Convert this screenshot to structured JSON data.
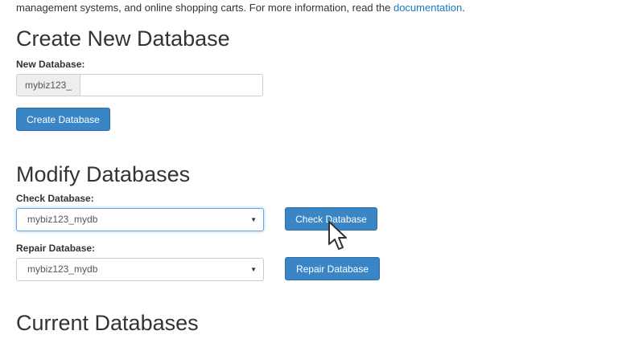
{
  "intro": {
    "text": "management systems, and online shopping carts. For more information, read the ",
    "link": "documentation",
    "end": "."
  },
  "create": {
    "heading": "Create New Database",
    "label": "New Database:",
    "prefix": "mybiz123_",
    "value": "",
    "button": "Create Database"
  },
  "modify": {
    "heading": "Modify Databases",
    "check_label": "Check Database:",
    "check_selected": "mybiz123_mydb",
    "check_button": "Check Database",
    "repair_label": "Repair Database:",
    "repair_selected": "mybiz123_mydb",
    "repair_button": "Repair Database"
  },
  "current": {
    "heading": "Current Databases"
  },
  "icons": {
    "select_caret": "chevron-down-icon",
    "pointer": "mouse-cursor-icon"
  },
  "colors": {
    "link": "#1a7ac1",
    "button": "#3a85c6",
    "focus_border": "#6aa6dd"
  }
}
